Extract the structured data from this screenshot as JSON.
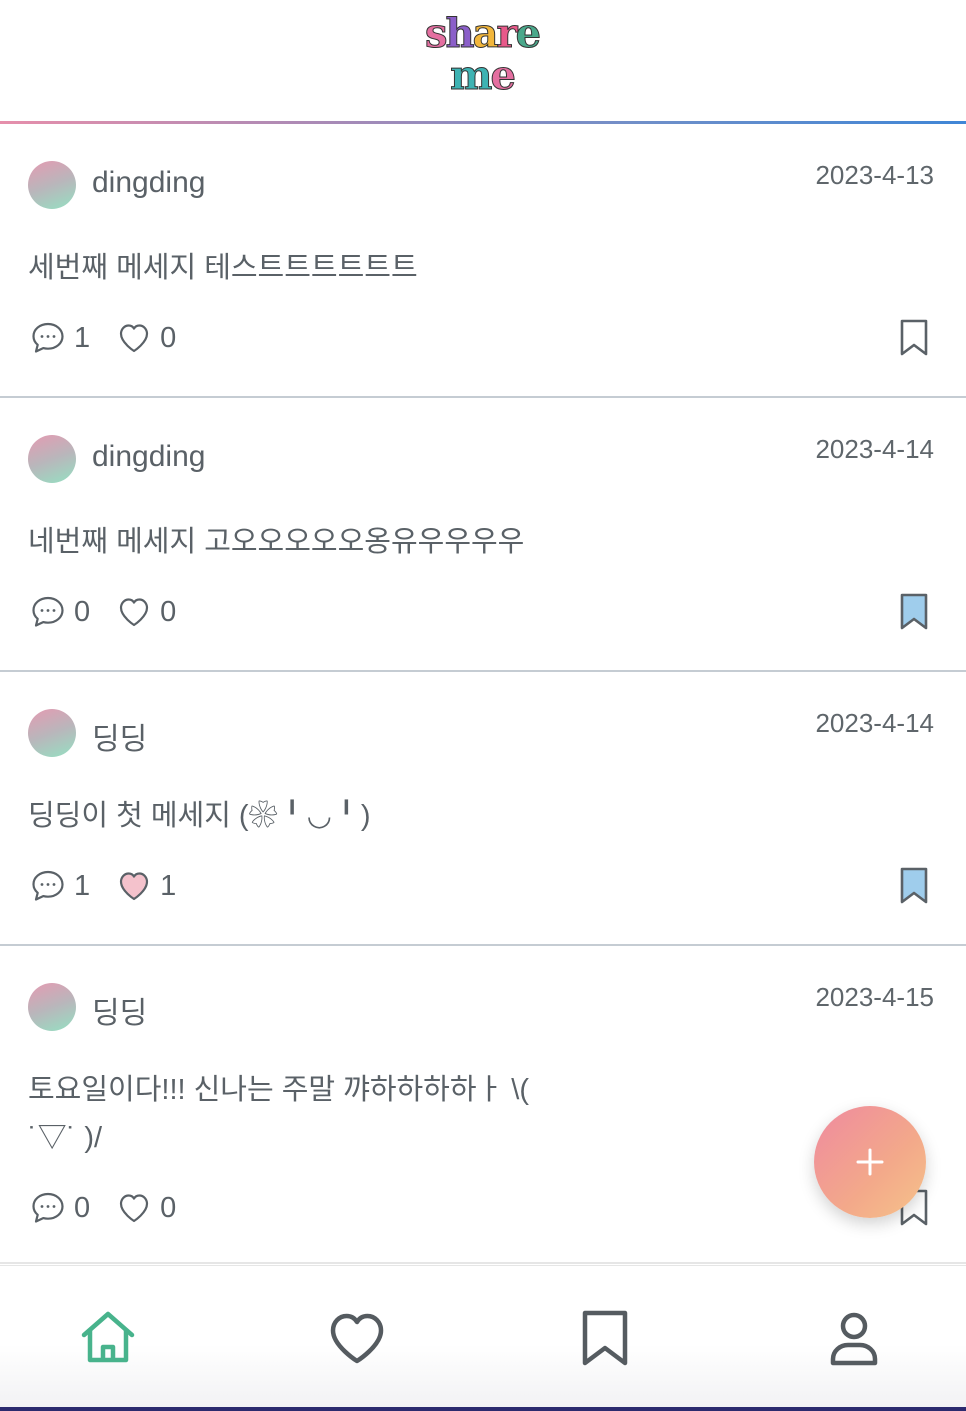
{
  "app": {
    "logo_line1": "share",
    "logo_line2": "me"
  },
  "colors": {
    "accent_gradient": [
      "#e68fab",
      "#3f86d6"
    ],
    "bookmark_active": "#9fcdec",
    "like_active": "#f4c2cc",
    "home_active": "#48b38c",
    "fab_gradient": [
      "#ef8a9f",
      "#f6c38a"
    ]
  },
  "posts": [
    {
      "username": "dingding",
      "date": "2023-4-13",
      "content": "세번째 메세지 테스트트트트트트",
      "comments": "1",
      "likes": "0",
      "liked": false,
      "bookmarked": false
    },
    {
      "username": "dingding",
      "date": "2023-4-14",
      "content": "네번째 메세지 고오오오오오옹유우우우우",
      "comments": "0",
      "likes": "0",
      "liked": false,
      "bookmarked": true
    },
    {
      "username": "딩딩",
      "date": "2023-4-14",
      "content": "딩딩이 첫 메세지 (❀╹◡╹)",
      "comments": "1",
      "likes": "1",
      "liked": true,
      "bookmarked": true
    },
    {
      "username": "딩딩",
      "date": "2023-4-15",
      "content": "토요일이다!!! 신나는 주말 꺄하하하하ㅏ \\( ˙▽˙ )/",
      "comments": "0",
      "likes": "0",
      "liked": false,
      "bookmarked": false
    }
  ],
  "fab": {
    "icon": "plus-icon"
  },
  "tabbar": {
    "items": [
      {
        "icon": "home-icon",
        "active": true
      },
      {
        "icon": "heart-icon",
        "active": false
      },
      {
        "icon": "bookmark-icon",
        "active": false
      },
      {
        "icon": "profile-icon",
        "active": false
      }
    ]
  }
}
